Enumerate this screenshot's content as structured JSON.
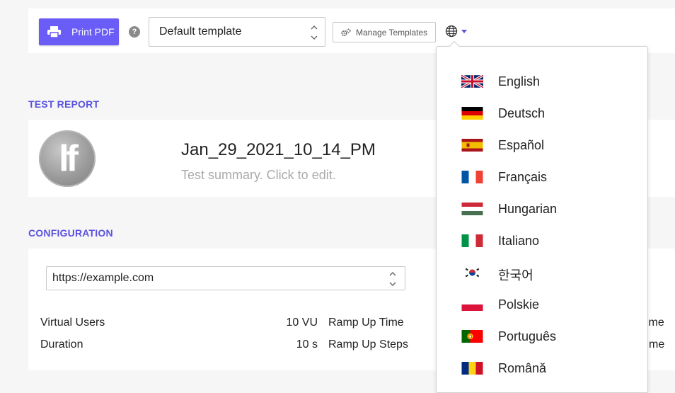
{
  "toolbar": {
    "print_label": "Print PDF",
    "help_glyph": "?",
    "template_value": "Default template",
    "manage_label": "Manage Templates",
    "accent_color": "#6a5cf6"
  },
  "report": {
    "section_title": "TEST REPORT",
    "logo_text": "lf",
    "name": "Jan_29_2021_10_14_PM",
    "summary": "Test summary. Click to edit."
  },
  "configuration": {
    "section_title": "CONFIGURATION",
    "url_value": "https://example.com",
    "rows": [
      {
        "label": "Virtual Users",
        "value": "10 VU",
        "label2": "Ramp Up Time",
        "cut": "ime"
      },
      {
        "label": "Duration",
        "value": "10 s",
        "label2": "Ramp Up Steps",
        "cut": "me"
      }
    ]
  },
  "language_menu": {
    "items": [
      {
        "name": "English",
        "flag": "uk-flag-icon"
      },
      {
        "name": "Deutsch",
        "flag": "germany-flag-icon"
      },
      {
        "name": "Español",
        "flag": "spain-flag-icon"
      },
      {
        "name": "Français",
        "flag": "france-flag-icon"
      },
      {
        "name": "Hungarian",
        "flag": "hungary-flag-icon"
      },
      {
        "name": "Italiano",
        "flag": "italy-flag-icon"
      },
      {
        "name": "한국어",
        "flag": "korea-flag-icon"
      },
      {
        "name": "Polskie",
        "flag": "poland-flag-icon"
      },
      {
        "name": "Português",
        "flag": "portugal-flag-icon"
      },
      {
        "name": "Română",
        "flag": "romania-flag-icon"
      }
    ]
  }
}
